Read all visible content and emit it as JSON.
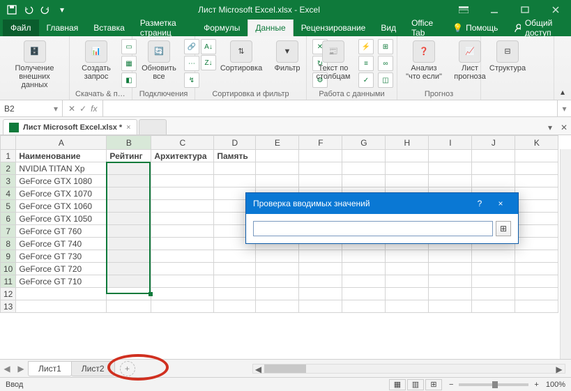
{
  "app": {
    "title": "Лист Microsoft Excel.xlsx - Excel"
  },
  "tabs": {
    "file": "Файл",
    "items": [
      "Главная",
      "Вставка",
      "Разметка страниц",
      "Формулы",
      "Данные",
      "Рецензирование",
      "Вид",
      "Office Tab",
      "Помощь"
    ],
    "active_index": 4,
    "share": "Общий доступ"
  },
  "ribbon": {
    "groups": [
      {
        "label": "Получение внешних данных",
        "big": "Получение внешних данных"
      },
      {
        "label": "Скачать & пр…",
        "big": "Создать запрос"
      },
      {
        "label": "Подключения",
        "big": "Обновить все"
      },
      {
        "label": "Сортировка и фильтр",
        "big1": "Сортировка",
        "big2": "Фильтр"
      },
      {
        "label": "Работа с данными",
        "big": "Текст по столбцам"
      },
      {
        "label": "Прогноз",
        "big1": "Анализ \"что если\"",
        "big2": "Лист прогноза"
      },
      {
        "label": "",
        "big": "Структура"
      }
    ]
  },
  "formula_bar": {
    "name_box": "B2",
    "fx": "fx",
    "value": ""
  },
  "office_tab": {
    "name": "Лист Microsoft Excel.xlsx *"
  },
  "grid": {
    "columns": [
      "A",
      "B",
      "C",
      "D",
      "E",
      "F",
      "G",
      "H",
      "I",
      "J",
      "K"
    ],
    "headers": {
      "A": "Наименование",
      "B": "Рейтинг",
      "C": "Архитектура",
      "D": "Память"
    },
    "rows": [
      "NVIDIA TITAN Xp",
      "GeForce GTX 1080",
      "GeForce GTX 1070",
      "GeForce GTX 1060",
      "GeForce GTX 1050",
      "GeForce GT 760",
      "GeForce GT 740",
      "GeForce GT 730",
      "GeForce GT 720",
      "GeForce GT 710"
    ],
    "visible_rows": 13
  },
  "dialog": {
    "title": "Проверка вводимых значений",
    "help": "?",
    "close": "×",
    "value": ""
  },
  "sheets": {
    "items": [
      "Лист1",
      "Лист2"
    ],
    "active_index": 0
  },
  "status": {
    "mode": "Ввод",
    "zoom": "100%"
  }
}
